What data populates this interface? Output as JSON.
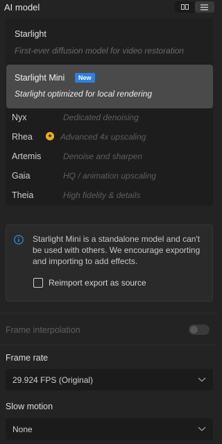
{
  "header": {
    "title": "AI model",
    "view_grid_icon": "grid-view-icon",
    "view_list_icon": "list-view-icon"
  },
  "models": {
    "starlight": {
      "name": "Starlight",
      "desc": "First-ever diffusion model for video restoration"
    },
    "starlight_mini": {
      "name": "Starlight Mini",
      "badge": "New",
      "desc": "Starlight optimized for local rendering"
    },
    "items": [
      {
        "name": "Nyx",
        "desc": "Dedicated denoising"
      },
      {
        "name": "Rhea",
        "desc": "Advanced 4x upscaling"
      },
      {
        "name": "Artemis",
        "desc": "Denoise and sharpen"
      },
      {
        "name": "Gaia",
        "desc": "HQ / animation upscaling"
      },
      {
        "name": "Theia",
        "desc": "High fidelity & details"
      }
    ]
  },
  "info": {
    "message": "Starlight Mini is a standalone model and can't be used with others. We encourage exporting and importing to add effects.",
    "checkbox_label": "Reimport export as source",
    "checkbox_checked": false
  },
  "frame_interpolation": {
    "label": "Frame interpolation",
    "enabled": false
  },
  "frame_rate": {
    "label": "Frame rate",
    "value": "29.924 FPS (Original)"
  },
  "slow_motion": {
    "label": "Slow motion",
    "value": "None"
  },
  "colors": {
    "accent": "#2f7fe0",
    "selected_bg": "#4a4a4a",
    "star": "#e7b416"
  }
}
